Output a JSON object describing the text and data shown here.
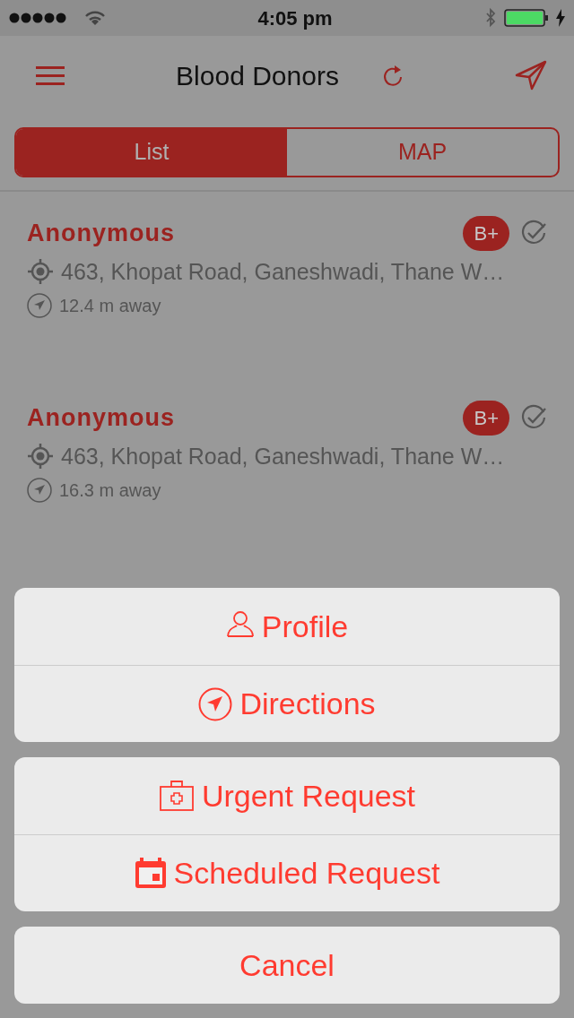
{
  "status_bar": {
    "time": "4:05 pm"
  },
  "nav": {
    "title": "Blood Donors"
  },
  "segments": [
    {
      "label": "List",
      "selected": true
    },
    {
      "label": "MAP",
      "selected": false
    }
  ],
  "donors": [
    {
      "name": "Anonymous",
      "blood_group": "B+",
      "address": "463, Khopat Road, Ganeshwadi, Thane W…",
      "distance": "12.4 m away",
      "verified": false
    },
    {
      "name": "Anonymous",
      "blood_group": "B+",
      "address": "463, Khopat Road, Ganeshwadi, Thane W…",
      "distance": "16.3 m away",
      "verified": false
    }
  ],
  "action_sheet": {
    "groups": [
      [
        {
          "label": "Profile",
          "kind": "person"
        },
        {
          "label": "Directions",
          "kind": "navigate"
        }
      ],
      [
        {
          "label": "Urgent Request",
          "kind": "firstaid"
        },
        {
          "label": "Scheduled Request",
          "kind": "calendar"
        }
      ]
    ],
    "cancel": "Cancel"
  }
}
